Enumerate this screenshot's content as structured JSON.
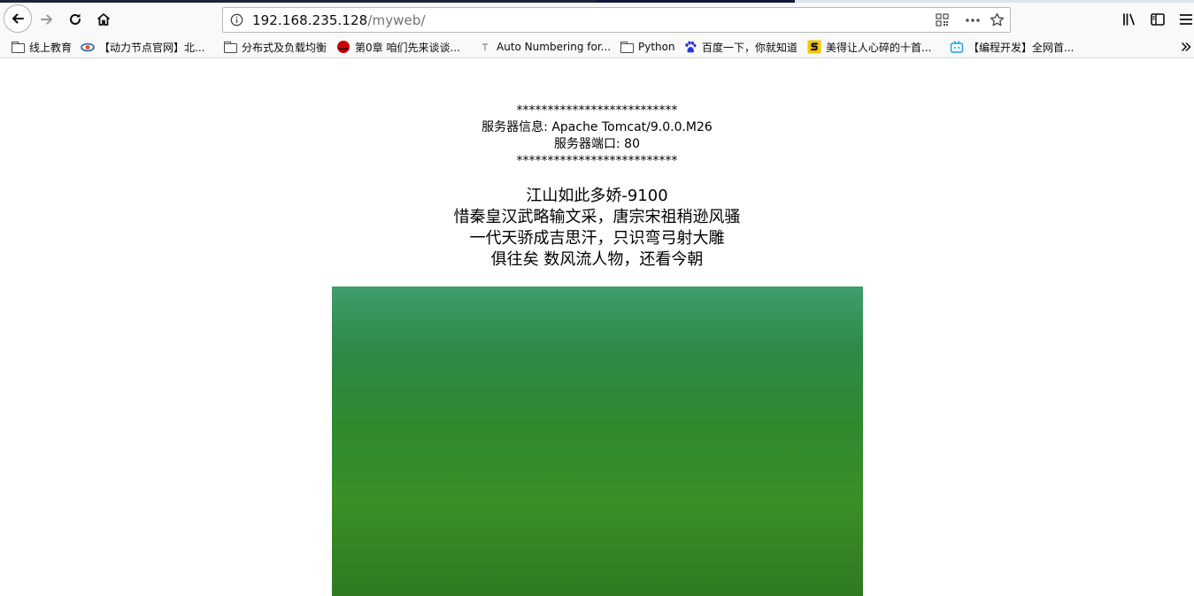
{
  "browser": {
    "url": {
      "host": "192.168.235.128",
      "path": "/myweb/"
    },
    "bookmarks": [
      {
        "label": "线上教育",
        "icon": "folder-icon"
      },
      {
        "label": "【动力节点官网】北...",
        "icon": "site-favicon-icon"
      },
      {
        "label": "分布式及负载均衡",
        "icon": "folder-icon"
      },
      {
        "label": "第0章 咱们先来谈谈...",
        "icon": "redhat-favicon-icon"
      },
      {
        "label": "Auto Numbering for...",
        "icon": "text-favicon-icon"
      },
      {
        "label": "Python",
        "icon": "folder-icon"
      },
      {
        "label": "百度一下，你就知道",
        "icon": "baidu-paw-icon"
      },
      {
        "label": "美得让人心碎的十首...",
        "icon": "sogou-favicon-icon"
      },
      {
        "label": "【编程开发】全网首...",
        "icon": "bilibili-tv-icon"
      }
    ],
    "colors": {
      "toolbar": "#f9f9fa",
      "url_path": "#737373"
    }
  },
  "page": {
    "server_info": {
      "separator_top": "**************************",
      "server": "服务器信息: Apache Tomcat/9.0.0.M26",
      "port": "服务器端口: 80",
      "separator_bottom": "**************************"
    },
    "poem": {
      "title": "江山如此多娇-9100",
      "lines": [
        "惜秦皇汉武略输文采，唐宗宋祖稍逊风骚",
        "一代天骄成吉思汗，只识弯弓射大雕",
        "俱往矣 数风流人物，还看今朝"
      ]
    }
  }
}
